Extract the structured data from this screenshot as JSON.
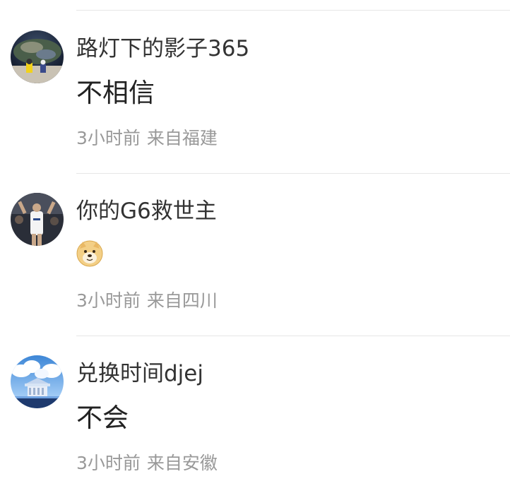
{
  "comments": [
    {
      "username": "路灯下的影子365",
      "text": "不相信",
      "time": "3小时前",
      "location": "来自福建"
    },
    {
      "username": "你的G6救世主",
      "emoji": "doge-emoji",
      "time": "3小时前",
      "location": "来自四川"
    },
    {
      "username": "兑换时间djej",
      "text": "不会",
      "time": "3小时前",
      "location": "来自安徽"
    }
  ],
  "colors": {
    "username": "#333333",
    "text": "#222222",
    "meta": "#999999",
    "divider": "#e6e6e6"
  }
}
